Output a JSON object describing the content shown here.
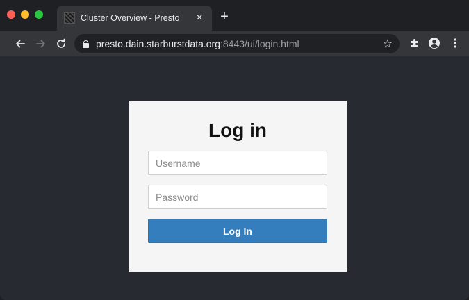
{
  "browser": {
    "tab_title": "Cluster Overview - Presto",
    "tab_close": "×",
    "new_tab": "+",
    "url_host": "presto.dain.starburstdata.org",
    "url_rest": ":8443/ui/login.html"
  },
  "login": {
    "title": "Log in",
    "username_placeholder": "Username",
    "password_placeholder": "Password",
    "submit_label": "Log In"
  },
  "colors": {
    "accent": "#357ebd",
    "page_background": "#282a31",
    "card_background": "#f5f5f5"
  }
}
